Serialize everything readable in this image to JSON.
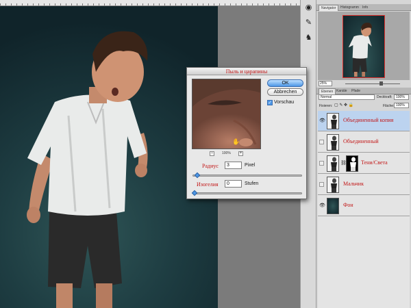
{
  "dialog": {
    "title": "Пыль и царапины",
    "ok_label": "OK",
    "cancel_label": "Abbrechen",
    "preview_label": "Vorschau",
    "preview_checked": true,
    "zoom_value": "100%",
    "zoom_out": "−",
    "zoom_in": "+",
    "radius_label": "Радиус",
    "radius_value": "3",
    "radius_unit": "Pixel",
    "threshold_label": "Изогелия",
    "threshold_value": "0",
    "threshold_unit": "Stufen"
  },
  "navigator": {
    "tabs": [
      "Navigator",
      "Histogramm",
      "Info"
    ],
    "active_tab": 0,
    "zoom": "25%"
  },
  "layers_panel": {
    "tabs": [
      "Ebenen",
      "Kanäle",
      "Pfade"
    ],
    "active_tab": 0,
    "blend_mode": "Normal",
    "opacity_label": "Deckkraft:",
    "opacity_value": "100%",
    "lock_label": "Fixieren:",
    "fill_label": "Fläche:",
    "fill_value": "100%",
    "layers": [
      {
        "name": "Объединенный копия",
        "visible": true,
        "selected": true,
        "thumb": "boy"
      },
      {
        "name": "Объединенный",
        "visible": false,
        "selected": false,
        "thumb": "boy"
      },
      {
        "name": "Тени/Света",
        "visible": false,
        "selected": false,
        "thumb": "mask"
      },
      {
        "name": "Мальчик",
        "visible": false,
        "selected": false,
        "thumb": "boy"
      },
      {
        "name": "Фон",
        "visible": true,
        "selected": false,
        "thumb": "bg"
      }
    ]
  },
  "tools": [
    "eye-dropper-icon",
    "brush-icon",
    "clone-stamp-icon"
  ],
  "colors": {
    "label_red": "#c21515",
    "accent_blue": "#4d97e6",
    "selected_row": "#bcd3ef",
    "navigator_frame": "#e0302c"
  }
}
